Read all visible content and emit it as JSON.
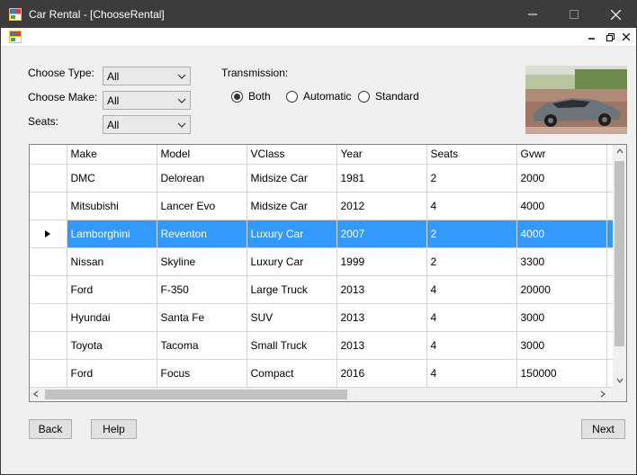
{
  "window": {
    "title": "Car Rental - [ChooseRental]"
  },
  "filters": {
    "type_label": "Choose Type:",
    "make_label": "Choose Make:",
    "seats_label": "Seats:",
    "type_value": "All",
    "make_value": "All",
    "seats_value": "All"
  },
  "transmission": {
    "label": "Transmission:",
    "options": [
      "Both",
      "Automatic",
      "Standard"
    ],
    "selected": "Both"
  },
  "grid": {
    "columns": [
      "Make",
      "Model",
      "VClass",
      "Year",
      "Seats",
      "Gvwr"
    ],
    "rows": [
      [
        "DMC",
        "Delorean",
        "Midsize Car",
        "1981",
        "2",
        "2000"
      ],
      [
        "Mitsubishi",
        "Lancer Evo",
        "Midsize Car",
        "2012",
        "4",
        "4000"
      ],
      [
        "Lamborghini",
        "Reventon",
        "Luxury Car",
        "2007",
        "2",
        "4000"
      ],
      [
        "Nissan",
        "Skyline",
        "Luxury Car",
        "1999",
        "2",
        "3300"
      ],
      [
        "Ford",
        "F-350",
        "Large Truck",
        "2013",
        "4",
        "20000"
      ],
      [
        "Hyundai",
        "Santa Fe",
        "SUV",
        "2013",
        "4",
        "3000"
      ],
      [
        "Toyota",
        "Tacoma",
        "Small Truck",
        "2013",
        "4",
        "3000"
      ],
      [
        "Ford",
        "Focus",
        "Compact",
        "2016",
        "4",
        "150000"
      ]
    ],
    "selected_row": 2
  },
  "buttons": {
    "back": "Back",
    "help": "Help",
    "next": "Next"
  },
  "colors": {
    "titlebar": "#3c3c3c",
    "selection": "#3399ff",
    "window": "#f0f0f0"
  }
}
